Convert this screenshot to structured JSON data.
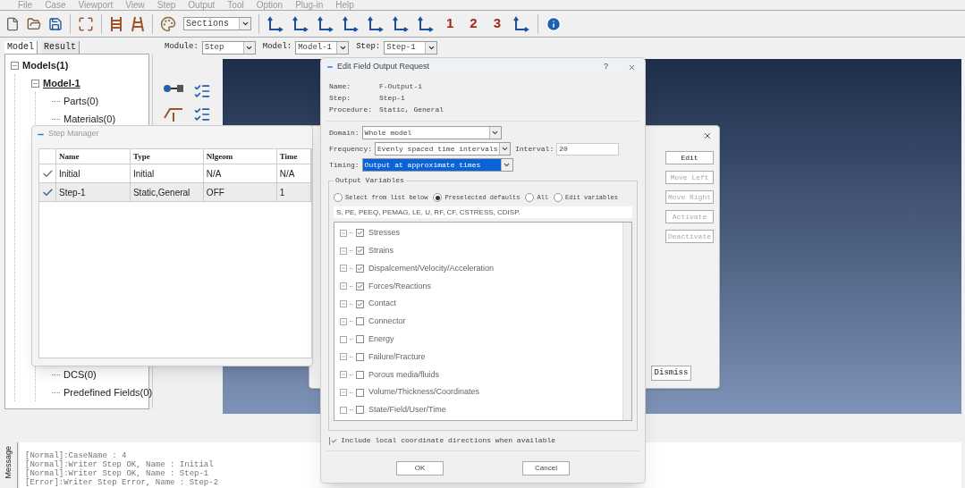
{
  "menu": [
    "File",
    "Case",
    "Viewport",
    "View",
    "Step",
    "Output",
    "Tool",
    "Option",
    "Plug-in",
    "Help"
  ],
  "toolbar": {
    "section_select": "Sections",
    "view_buttons": [
      "1",
      "2",
      "3"
    ]
  },
  "tabs": [
    {
      "label": "Model",
      "selected": true
    },
    {
      "label": "Result",
      "selected": false
    }
  ],
  "tree": [
    {
      "label": "Models(1)",
      "expanded": true,
      "children": [
        {
          "label": "Model-1",
          "expanded": true,
          "children": [
            {
              "label": "Parts(0)"
            },
            {
              "label": "Materials(0)"
            },
            {
              "label": "DCS(0)"
            },
            {
              "label": "Predefined Fields(0)"
            }
          ]
        }
      ]
    }
  ],
  "context": [
    {
      "label": "Module:",
      "value": "Step"
    },
    {
      "label": "Model:",
      "value": "Model-1"
    },
    {
      "label": "Step:",
      "value": "Step-1"
    }
  ],
  "step_manager": {
    "title": "Step Manager",
    "columns": [
      "Name",
      "Type",
      "Nlgeom",
      "Time"
    ],
    "rows": [
      {
        "active": true,
        "selected": false,
        "cells": [
          "Initial",
          "Initial",
          "N/A",
          "N/A"
        ]
      },
      {
        "active": true,
        "selected": true,
        "cells": [
          "Step-1",
          "Static,General",
          "OFF",
          "1"
        ]
      }
    ]
  },
  "manager_buttons": [
    {
      "label": "Edit",
      "disabled": false
    },
    {
      "label": "Move Left",
      "disabled": true
    },
    {
      "label": "Move Right",
      "disabled": true
    },
    {
      "label": "Activate",
      "disabled": true
    },
    {
      "label": "Deactivate",
      "disabled": true
    }
  ],
  "dismiss": "Dismiss",
  "dialog": {
    "title": "Edit Field Output Request",
    "help": "?",
    "info": [
      {
        "label": "Name:",
        "value": "F-Output-1"
      },
      {
        "label": "Step:",
        "value": "Step-1"
      },
      {
        "label": "Procedure:",
        "value": "Static, General"
      }
    ],
    "domain": {
      "label": "Domain:",
      "value": "Whole model"
    },
    "frequency": {
      "label": "Frequency:",
      "value": "Evenly spaced time intervals"
    },
    "interval": {
      "label": "Interval:",
      "value": "20"
    },
    "timing": {
      "label": "Timing:",
      "value": "Output at approximate times",
      "highlighted": true
    },
    "group_title": "Output Variables",
    "radios": [
      {
        "label": "Select from list below",
        "selected": false
      },
      {
        "label": "Preselected defaults",
        "selected": true
      },
      {
        "label": "All",
        "selected": false
      },
      {
        "label": "Edit variables",
        "selected": false
      }
    ],
    "variables_text": "S, PE, PEEQ, PEMAG, LE, U, RF, CF, CSTRESS, CDISP.",
    "variables": [
      {
        "label": "Stresses",
        "checked": true,
        "has_children": true
      },
      {
        "label": "Strains",
        "checked": true,
        "has_children": true
      },
      {
        "label": "Dispalcement/Velocity/Acceleration",
        "checked": true,
        "has_children": true
      },
      {
        "label": "Forces/Reactions",
        "checked": true,
        "has_children": true
      },
      {
        "label": "Contact",
        "checked": true,
        "has_children": true
      },
      {
        "label": "Connector",
        "checked": false,
        "has_children": true
      },
      {
        "label": "Energy",
        "checked": false,
        "has_children": false
      },
      {
        "label": "Failure/Fracture",
        "checked": false,
        "has_children": true
      },
      {
        "label": "Porous media/fluids",
        "checked": false,
        "has_children": true
      },
      {
        "label": "Volume/Thickness/Coordinates",
        "checked": false,
        "has_children": true
      },
      {
        "label": "State/Field/User/Time",
        "checked": false,
        "has_children": false
      }
    ],
    "local_coords": {
      "label": "Include local coordinate directions when available",
      "checked": true
    },
    "buttons": [
      "OK",
      "Cancel"
    ]
  },
  "messages": {
    "tab": "Message",
    "lines": [
      "[Normal]:CaseName : 4",
      "[Normal]:Writer Step OK, Name : Initial",
      "[Normal]:Writer Step OK, Name : Step-1",
      "[Error]:Writer Step Error, Name : Step-2"
    ]
  }
}
